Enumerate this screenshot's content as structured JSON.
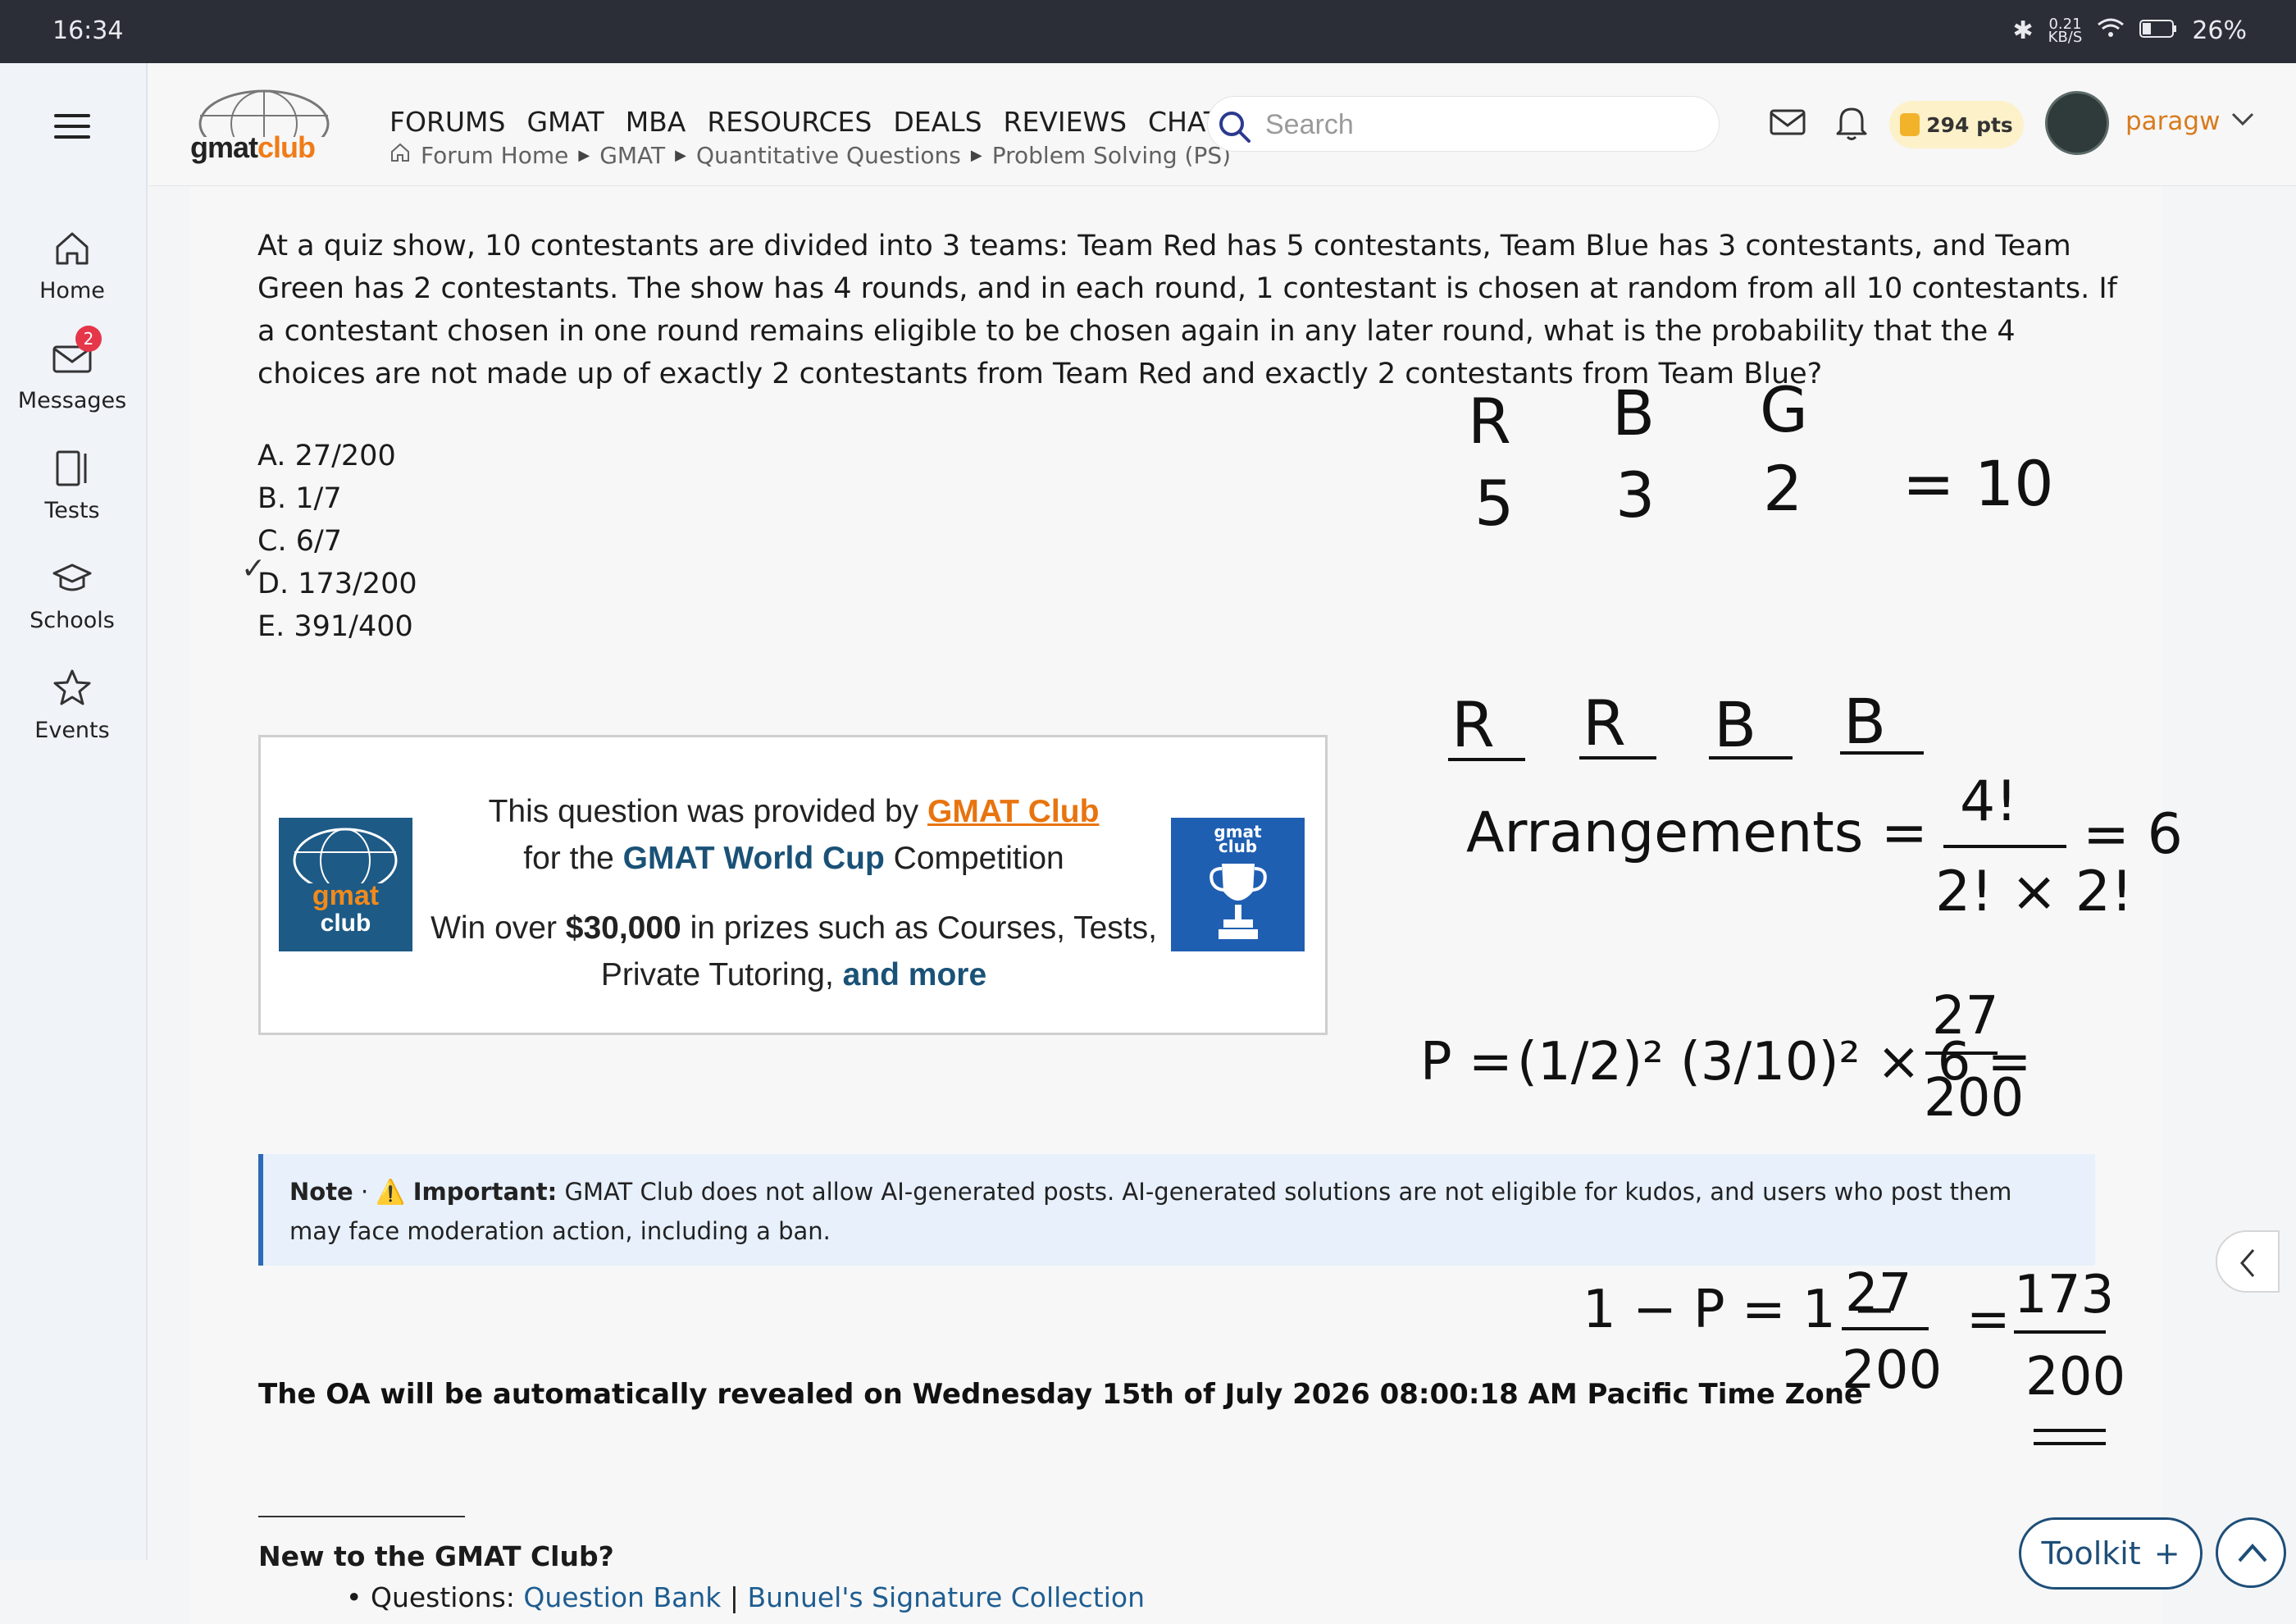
{
  "status_bar": {
    "time": "16:34",
    "net_speed_value": "0.21",
    "net_speed_unit": "KB/S",
    "battery": "26%"
  },
  "sidebar": {
    "items": [
      {
        "label": "Home",
        "icon": "home-icon"
      },
      {
        "label": "Messages",
        "icon": "mail-icon",
        "badge": "2"
      },
      {
        "label": "Tests",
        "icon": "tests-icon"
      },
      {
        "label": "Schools",
        "icon": "graduation-cap-icon"
      },
      {
        "label": "Events",
        "icon": "star-icon"
      }
    ]
  },
  "header": {
    "logo": {
      "part1": "gmat",
      "part2": "club"
    },
    "nav": [
      "FORUMS",
      "GMAT",
      "MBA",
      "RESOURCES",
      "DEALS",
      "REVIEWS",
      "CHAT"
    ],
    "breadcrumb": [
      "Forum Home",
      "GMAT",
      "Quantitative Questions",
      "Problem Solving (PS)"
    ],
    "search_placeholder": "Search",
    "points": "294 pts",
    "username": "paragw"
  },
  "question": {
    "text": "At a quiz show, 10 contestants are divided into 3 teams: Team Red has 5 contestants, Team Blue has 3 contestants, and Team Green has 2 contestants. The show has 4 rounds, and in each round, 1 contestant is chosen at random from all 10 contestants. If a contestant chosen in one round remains eligible to be chosen again in any later round, what is the probability that the 4 choices are not made up of exactly 2 contestants from Team Red and exactly 2 contestants from Team Blue?",
    "options": [
      "A. 27/200",
      "B. 1/7",
      "C. 6/7",
      "D. 173/200",
      "E. 391/400"
    ]
  },
  "promo": {
    "line1_a": "This question was provided by ",
    "line1_link": "GMAT Club",
    "line2_a": "for the ",
    "line2_bold": "GMAT World Cup",
    "line2_b": " Competition",
    "line3_a": "Win over ",
    "line3_bold": "$30,000",
    "line3_b": " in prizes such as Courses, Tests,",
    "line4_a": "Private Tutoring, ",
    "line4_link": "and more",
    "left_logo": {
      "part1": "gmat",
      "part2": "club"
    },
    "right_logo": {
      "part1": "gmat",
      "part2": "club"
    }
  },
  "note": {
    "label": "Note",
    "important_label": "Important:",
    "text": "GMAT Club does not allow AI-generated posts. AI-generated solutions are not eligible for kudos, and users who post them may face moderation action, including a ban."
  },
  "oa_text": "The OA will be automatically revealed on Wednesday 15th of July 2026 08:00:18 AM Pacific Time Zone",
  "signature": {
    "heading": "New to the GMAT Club?",
    "questions_label": "Questions: ",
    "link1": "Question Bank",
    "divider": " | ",
    "link2": "Bunuel's Signature Collection"
  },
  "handwriting": {
    "headers": [
      "R",
      "B",
      "G"
    ],
    "counts": [
      "5",
      "3",
      "2"
    ],
    "total": "= 10",
    "slots": [
      "R",
      "R",
      "B",
      "B"
    ],
    "arrangements_label": "Arrangements =",
    "arr_num": "4!",
    "arr_den": "2! × 2!",
    "arr_result": "= 6",
    "p_label": "P =",
    "p_expr": "(1/2)² (3/10)² × 6 =",
    "p_num": "27",
    "p_den": "200",
    "comp_label": "1 − P = 1 −",
    "comp_num1": "27",
    "comp_den1": "200",
    "comp_eq": "=",
    "comp_num2": "173",
    "comp_den2": "200"
  },
  "buttons": {
    "toolkit": "Toolkit",
    "toolkit_plus": "+"
  }
}
